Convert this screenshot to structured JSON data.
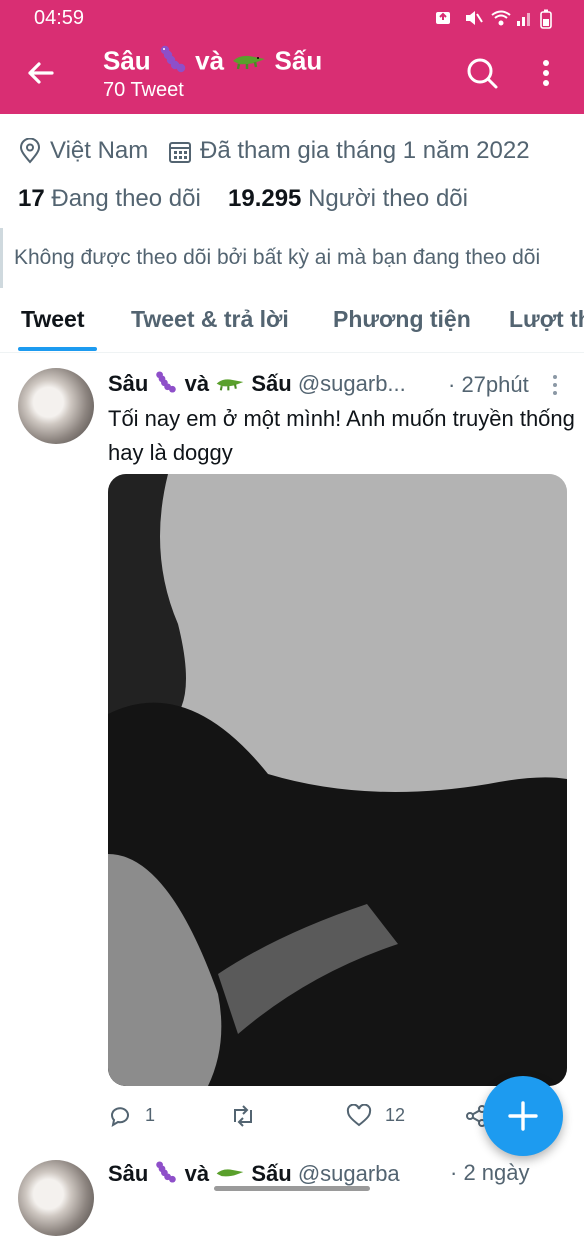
{
  "status_bar": {
    "time": "04:59"
  },
  "header": {
    "title_parts": [
      "Sâu",
      "và",
      "Sấu"
    ],
    "subtitle": "70 Tweet",
    "color": "#d92e73"
  },
  "profile": {
    "location": "Việt Nam",
    "joined": "Đã tham gia tháng 1 năm 2022",
    "following_count": "17",
    "following_label": "Đang theo dõi",
    "followers_count": "19.295",
    "followers_label": "Người theo dõi",
    "not_followed_text": "Không được theo dõi bởi bất kỳ ai mà bạn đang theo dõi"
  },
  "tabs": [
    {
      "label": "Tweet",
      "active": true
    },
    {
      "label": "Tweet & trả lời",
      "active": false
    },
    {
      "label": "Phương tiện",
      "active": false
    },
    {
      "label": "Lượt th",
      "active": false
    }
  ],
  "tweet": {
    "name_parts": [
      "Sâu",
      "và",
      "Sấu"
    ],
    "handle": "@sugarb...",
    "time": "· 27phút",
    "text": "Tối nay em ở một mình! Anh muốn truyền thống hay là doggy",
    "reply_count": "1",
    "like_count": "12"
  },
  "tweet2": {
    "name_parts": [
      "Sâu",
      "và",
      "Sấu"
    ],
    "handle": "@sugarba",
    "time": "· 2 ngày"
  },
  "icons": {
    "worm": "caterpillar-emoji",
    "croc": "crocodile-emoji",
    "accent": "#1d9bf0"
  }
}
